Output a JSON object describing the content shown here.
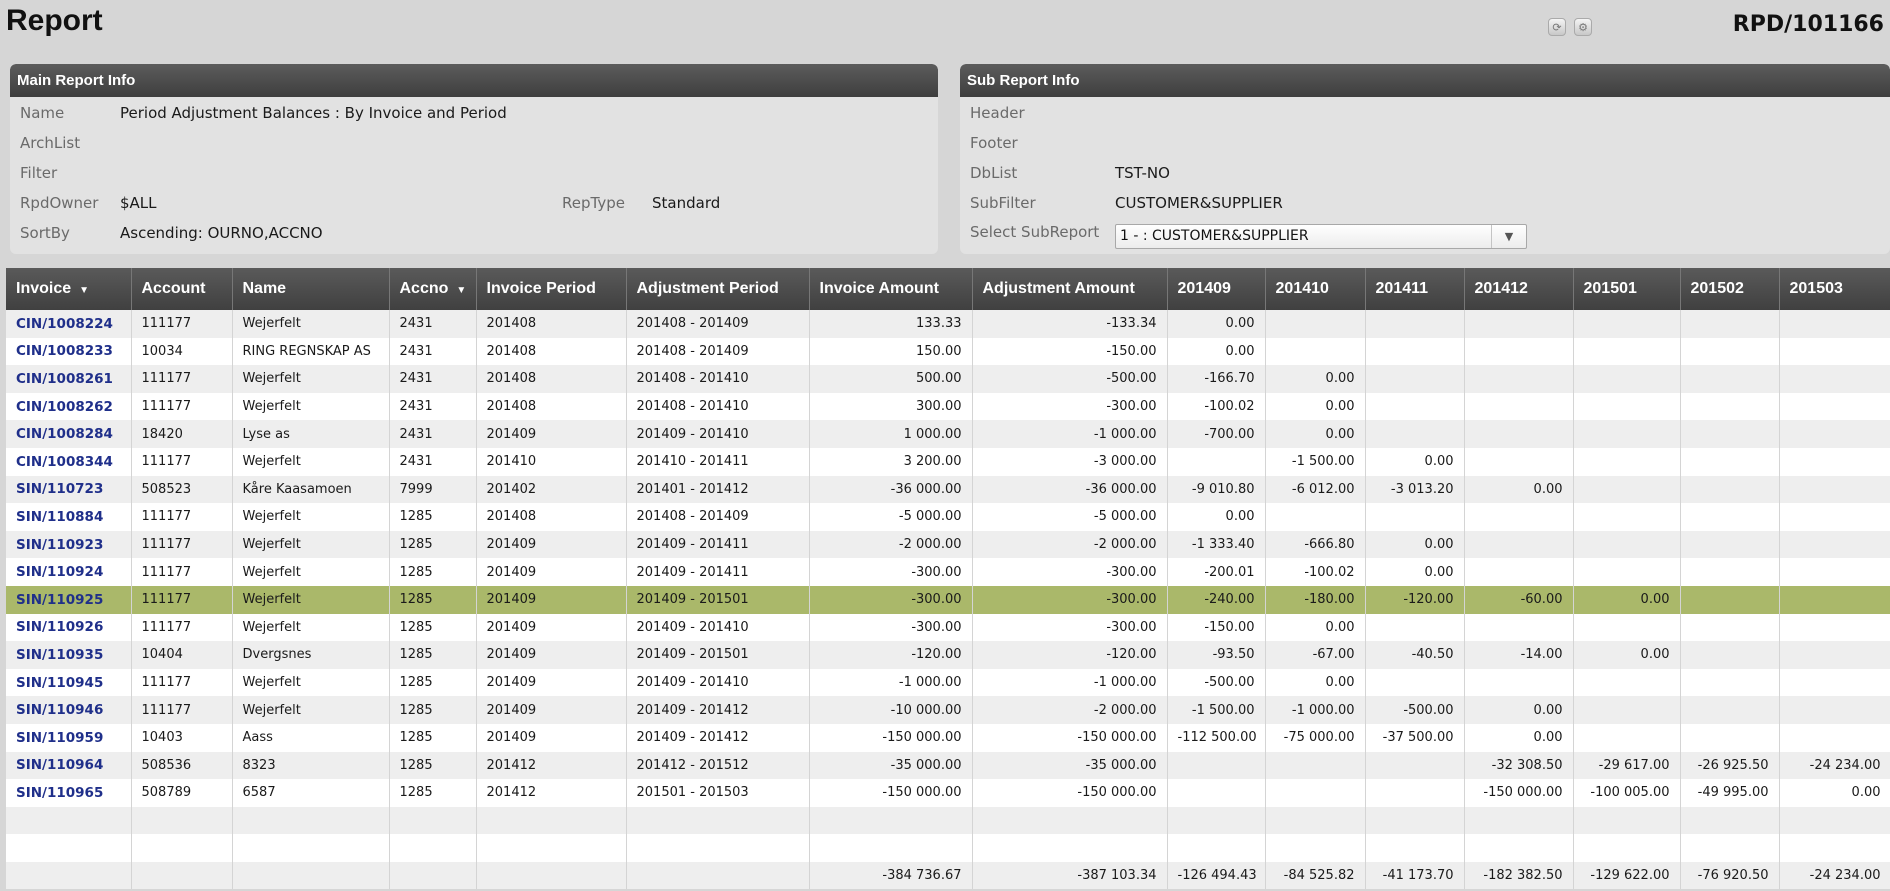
{
  "page": {
    "title": "Report",
    "id": "RPD/101166"
  },
  "toolbar": {
    "icons": [
      "refresh-icon",
      "settings-icon"
    ]
  },
  "main_info": {
    "header": "Main Report Info",
    "name_label": "Name",
    "name_value": "Period Adjustment Balances : By Invoice and Period",
    "archlist_label": "ArchList",
    "filter_label": "Filter",
    "rpdowner_label": "RpdOwner",
    "rpdowner_value": "$ALL",
    "reptype_label": "RepType",
    "reptype_value": "Standard",
    "sortby_label": "SortBy",
    "sortby_value": "Ascending: OURNO,ACCNO"
  },
  "sub_info": {
    "header": "Sub Report Info",
    "header_label": "Header",
    "footer_label": "Footer",
    "dblist_label": "DbList",
    "dblist_value": "TST-NO",
    "subfilter_label": "SubFilter",
    "subfilter_value": "CUSTOMER&SUPPLIER",
    "select_label": "Select SubReport",
    "select_value": "1 - : CUSTOMER&SUPPLIER"
  },
  "table": {
    "columns": [
      "Invoice",
      "Account",
      "Name",
      "Accno",
      "Invoice Period",
      "Adjustment Period",
      "Invoice Amount",
      "Adjustment Amount",
      "201409",
      "201410",
      "201411",
      "201412",
      "201501",
      "201502",
      "201503"
    ],
    "rows": [
      [
        "CIN/1008224",
        "111177",
        "Wejerfelt",
        "2431",
        "201408",
        "201408 - 201409",
        "133.33",
        "-133.34",
        "0.00",
        "",
        "",
        "",
        "",
        "",
        ""
      ],
      [
        "CIN/1008233",
        "10034",
        "RING REGNSKAP AS",
        "2431",
        "201408",
        "201408 - 201409",
        "150.00",
        "-150.00",
        "0.00",
        "",
        "",
        "",
        "",
        "",
        ""
      ],
      [
        "CIN/1008261",
        "111177",
        "Wejerfelt",
        "2431",
        "201408",
        "201408 - 201410",
        "500.00",
        "-500.00",
        "-166.70",
        "0.00",
        "",
        "",
        "",
        "",
        ""
      ],
      [
        "CIN/1008262",
        "111177",
        "Wejerfelt",
        "2431",
        "201408",
        "201408 - 201410",
        "300.00",
        "-300.00",
        "-100.02",
        "0.00",
        "",
        "",
        "",
        "",
        ""
      ],
      [
        "CIN/1008284",
        "18420",
        "Lyse as",
        "2431",
        "201409",
        "201409 - 201410",
        "1 000.00",
        "-1 000.00",
        "-700.00",
        "0.00",
        "",
        "",
        "",
        "",
        ""
      ],
      [
        "CIN/1008344",
        "111177",
        "Wejerfelt",
        "2431",
        "201410",
        "201410 - 201411",
        "3 200.00",
        "-3 000.00",
        "",
        "-1 500.00",
        "0.00",
        "",
        "",
        "",
        ""
      ],
      [
        "SIN/110723",
        "508523",
        "Kåre Kaasamoen",
        "7999",
        "201402",
        "201401 - 201412",
        "-36 000.00",
        "-36 000.00",
        "-9 010.80",
        "-6 012.00",
        "-3 013.20",
        "0.00",
        "",
        "",
        ""
      ],
      [
        "SIN/110884",
        "111177",
        "Wejerfelt",
        "1285",
        "201408",
        "201408 - 201409",
        "-5 000.00",
        "-5 000.00",
        "0.00",
        "",
        "",
        "",
        "",
        "",
        ""
      ],
      [
        "SIN/110923",
        "111177",
        "Wejerfelt",
        "1285",
        "201409",
        "201409 - 201411",
        "-2 000.00",
        "-2 000.00",
        "-1 333.40",
        "-666.80",
        "0.00",
        "",
        "",
        "",
        ""
      ],
      [
        "SIN/110924",
        "111177",
        "Wejerfelt",
        "1285",
        "201409",
        "201409 - 201411",
        "-300.00",
        "-300.00",
        "-200.01",
        "-100.02",
        "0.00",
        "",
        "",
        "",
        ""
      ],
      [
        "SIN/110925",
        "111177",
        "Wejerfelt",
        "1285",
        "201409",
        "201409 - 201501",
        "-300.00",
        "-300.00",
        "-240.00",
        "-180.00",
        "-120.00",
        "-60.00",
        "0.00",
        "",
        ""
      ],
      [
        "SIN/110926",
        "111177",
        "Wejerfelt",
        "1285",
        "201409",
        "201409 - 201410",
        "-300.00",
        "-300.00",
        "-150.00",
        "0.00",
        "",
        "",
        "",
        "",
        ""
      ],
      [
        "SIN/110935",
        "10404",
        "Dvergsnes",
        "1285",
        "201409",
        "201409 - 201501",
        "-120.00",
        "-120.00",
        "-93.50",
        "-67.00",
        "-40.50",
        "-14.00",
        "0.00",
        "",
        ""
      ],
      [
        "SIN/110945",
        "111177",
        "Wejerfelt",
        "1285",
        "201409",
        "201409 - 201410",
        "-1 000.00",
        "-1 000.00",
        "-500.00",
        "0.00",
        "",
        "",
        "",
        "",
        ""
      ],
      [
        "SIN/110946",
        "111177",
        "Wejerfelt",
        "1285",
        "201409",
        "201409 - 201412",
        "-10 000.00",
        "-2 000.00",
        "-1 500.00",
        "-1 000.00",
        "-500.00",
        "0.00",
        "",
        "",
        ""
      ],
      [
        "SIN/110959",
        "10403",
        "Aass",
        "1285",
        "201409",
        "201409 - 201412",
        "-150 000.00",
        "-150 000.00",
        "-112 500.00",
        "-75 000.00",
        "-37 500.00",
        "0.00",
        "",
        "",
        ""
      ],
      [
        "SIN/110964",
        "508536",
        "8323",
        "1285",
        "201412",
        "201412 - 201512",
        "-35 000.00",
        "-35 000.00",
        "",
        "",
        "",
        "-32 308.50",
        "-29 617.00",
        "-26 925.50",
        "-24 234.00"
      ],
      [
        "SIN/110965",
        "508789",
        "6587",
        "1285",
        "201412",
        "201501 - 201503",
        "-150 000.00",
        "-150 000.00",
        "",
        "",
        "",
        "-150 000.00",
        "-100 005.00",
        "-49 995.00",
        "0.00"
      ]
    ],
    "selected_row": 10,
    "totals": [
      "",
      "",
      "",
      "",
      "",
      "",
      "-384 736.67",
      "-387 103.34",
      "-126 494.43",
      "-84 525.82",
      "-41 173.70",
      "-182 382.50",
      "-129 622.00",
      "-76 920.50",
      "-24 234.00"
    ],
    "colors": {
      "header": "#4a4a4a",
      "selected": "#aab86a",
      "link": "#1f2f8a"
    }
  }
}
